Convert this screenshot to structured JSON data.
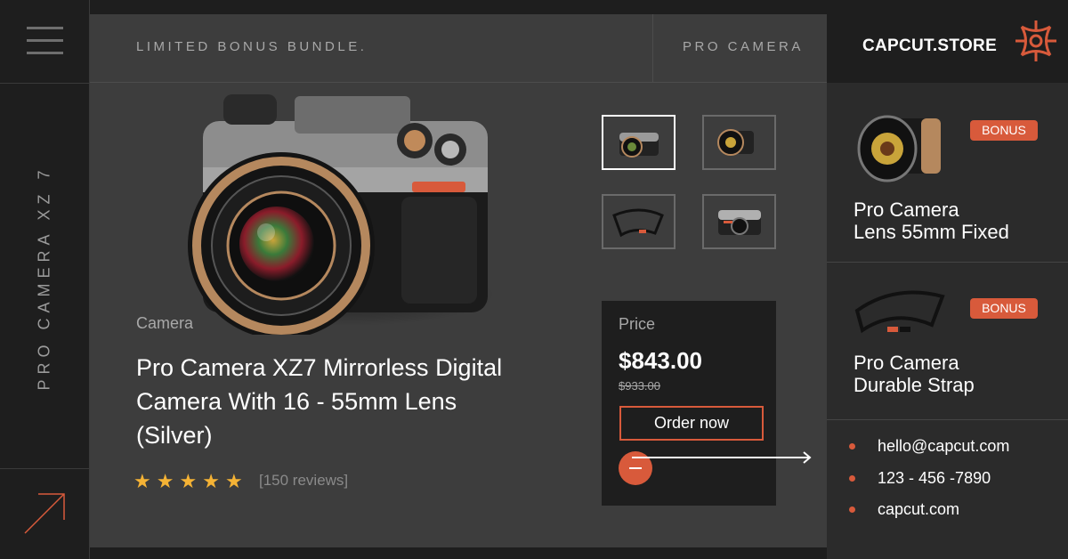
{
  "rail": {
    "vertical_label": "PRO CAMERA XZ 7",
    "menu_icon": "hamburger-icon",
    "arrow_icon": "arrow-up-right-icon"
  },
  "header": {
    "bundle_text": "LIMITED BONUS BUNDLE.",
    "category_tag": "PRO CAMERA"
  },
  "product": {
    "category": "Camera",
    "title": "Pro Camera XZ7 Mirrorless Digital Camera With 16 - 55mm Lens (Silver)",
    "rating": 5,
    "reviews": "[150 reviews]",
    "thumbnails": [
      "camera-front",
      "lens",
      "strap",
      "camera-side"
    ]
  },
  "price": {
    "label": "Price",
    "current": "$843.00",
    "old": "$933.00",
    "cta": "Order now"
  },
  "brand": {
    "name": "CAPCUT.STORE",
    "logo_icon": "brand-logo-icon"
  },
  "bonuses": [
    {
      "badge": "BONUS",
      "title_line1": "Pro Camera",
      "title_line2": "Lens 55mm Fixed"
    },
    {
      "badge": "BONUS",
      "title_line1": "Pro Camera",
      "title_line2": "Durable Strap"
    }
  ],
  "contacts": {
    "email": "hello@capcut.com",
    "phone": "123 - 456 -7890",
    "site": "capcut.com"
  },
  "colors": {
    "accent": "#d85a3b",
    "panel": "#3d3d3d",
    "dark": "#1e1e1e",
    "star": "#f5b335"
  }
}
